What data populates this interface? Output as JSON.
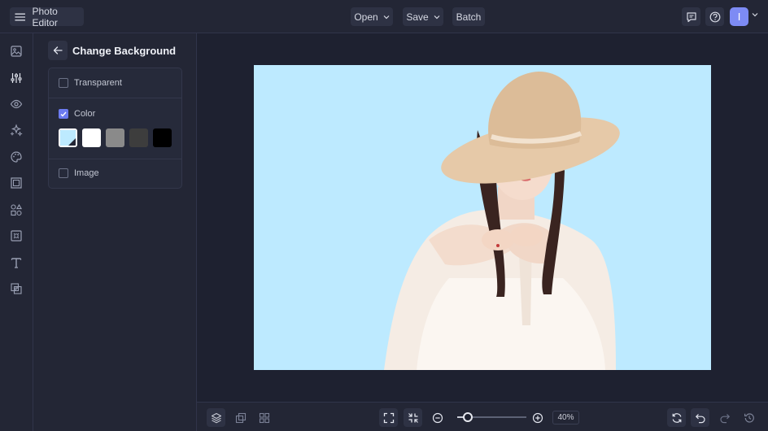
{
  "app": {
    "title": "Photo Editor",
    "avatar_letter": "I"
  },
  "topbar": {
    "open_label": "Open",
    "save_label": "Save",
    "batch_label": "Batch"
  },
  "sidebar_tools": [
    "image-icon",
    "sliders-icon",
    "eye-icon",
    "sparkle-icon",
    "palette-icon",
    "frame-icon",
    "shapes-icon",
    "texture-icon",
    "text-icon",
    "overlay-icon"
  ],
  "panel": {
    "title": "Change Background",
    "options": [
      {
        "label": "Transparent",
        "checked": false
      },
      {
        "label": "Color",
        "checked": true
      },
      {
        "label": "Image",
        "checked": false
      }
    ],
    "swatches": [
      "#bdeaff",
      "#ffffff",
      "#8a8a8a",
      "#3d3d3d",
      "#000000"
    ],
    "selected_swatch": 0
  },
  "canvas": {
    "background_color": "#bdeaff"
  },
  "bottombar": {
    "zoom_percent": 40,
    "zoom_label": "40%"
  },
  "colors": {
    "accent": "#6c7bf0",
    "avatar": "#7d8bf4",
    "chrome": "#232635",
    "workspace": "#1e2130"
  }
}
